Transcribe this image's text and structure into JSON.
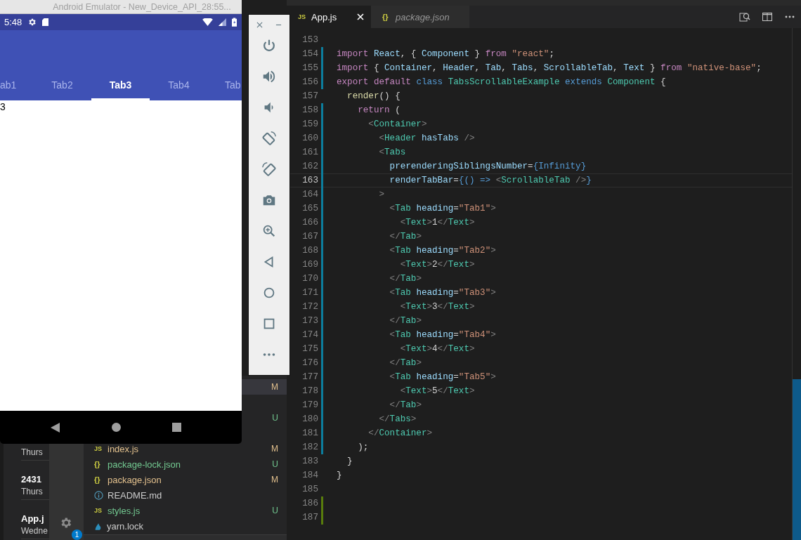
{
  "emulator": {
    "title": "Android Emulator - New_Device_API_28:55...",
    "clock": "5:48",
    "tabs": [
      {
        "label": "ab1",
        "selected": false
      },
      {
        "label": "Tab2",
        "selected": false
      },
      {
        "label": "Tab3",
        "selected": true
      },
      {
        "label": "Tab4",
        "selected": false
      },
      {
        "label": "Tab",
        "selected": false
      }
    ],
    "content": "3"
  },
  "editor": {
    "tabs": [
      {
        "label": "App.js",
        "icon_text": "JS",
        "selected": true,
        "preview": false
      },
      {
        "label": "package.json",
        "icon_text": "{}",
        "selected": false,
        "preview": true
      }
    ],
    "lines": [
      {
        "number": "153",
        "current": false
      },
      {
        "number": "154",
        "current": false,
        "color": "#0c7d9d",
        "tokens": [
          {
            "t": "import",
            "kind": "keyword"
          },
          {
            "t": " React",
            "kind": "variable"
          },
          {
            "t": ", {",
            "kind": "plain"
          },
          {
            "t": " Component",
            "kind": "variable"
          },
          {
            "t": " }",
            "kind": "plain"
          },
          {
            "t": " from",
            "kind": "keyword"
          },
          {
            "t": " \"react\"",
            "kind": "string"
          },
          {
            "t": ";",
            "kind": "plain"
          }
        ]
      },
      {
        "number": "155",
        "current": false,
        "color": "#0c7d9d",
        "tokens": [
          {
            "t": "import",
            "kind": "keyword"
          },
          {
            "t": " {",
            "kind": "plain"
          },
          {
            "t": " Container",
            "kind": "variable"
          },
          {
            "t": ",",
            "kind": "plain"
          },
          {
            "t": " Header",
            "kind": "variable"
          },
          {
            "t": ",",
            "kind": "plain"
          },
          {
            "t": " Tab",
            "kind": "variable"
          },
          {
            "t": ",",
            "kind": "plain"
          },
          {
            "t": " Tabs",
            "kind": "variable"
          },
          {
            "t": ",",
            "kind": "plain"
          },
          {
            "t": " ScrollableTab",
            "kind": "variable"
          },
          {
            "t": ",",
            "kind": "plain"
          },
          {
            "t": " Text",
            "kind": "variable"
          },
          {
            "t": " }",
            "kind": "plain"
          },
          {
            "t": " from",
            "kind": "keyword"
          },
          {
            "t": " \"native-base\"",
            "kind": "string"
          },
          {
            "t": ";",
            "kind": "plain"
          }
        ]
      },
      {
        "number": "156",
        "current": false,
        "color": "#0c7d9d",
        "tokens": [
          {
            "t": "export",
            "kind": "keyword"
          },
          {
            "t": " default",
            "kind": "keyword"
          },
          {
            "t": " class",
            "kind": "storage"
          },
          {
            "t": " TabsScrollableExample",
            "kind": "class"
          },
          {
            "t": " extends",
            "kind": "storage"
          },
          {
            "t": " Component",
            "kind": "class"
          },
          {
            "t": " {",
            "kind": "plain"
          }
        ]
      },
      {
        "number": "157",
        "current": false,
        "tokens": [
          {
            "t": "  render",
            "kind": "function"
          },
          {
            "t": "() {",
            "kind": "plain"
          }
        ]
      },
      {
        "number": "158",
        "current": false,
        "color": "#0c7d9d",
        "tokens": [
          {
            "t": "    return",
            "kind": "keyword"
          },
          {
            "t": " (",
            "kind": "plain"
          }
        ]
      },
      {
        "number": "159",
        "current": false,
        "color": "#0c7d9d",
        "tokens": [
          {
            "t": "      <",
            "kind": "bracket"
          },
          {
            "t": "Container",
            "kind": "class"
          },
          {
            "t": ">",
            "kind": "bracket"
          }
        ]
      },
      {
        "number": "160",
        "current": false,
        "color": "#0c7d9d",
        "tokens": [
          {
            "t": "        <",
            "kind": "bracket"
          },
          {
            "t": "Header",
            "kind": "class"
          },
          {
            "t": " hasTabs",
            "kind": "variable"
          },
          {
            "t": " />",
            "kind": "bracket"
          }
        ]
      },
      {
        "number": "161",
        "current": false,
        "color": "#0c7d9d",
        "tokens": [
          {
            "t": "        <",
            "kind": "bracket"
          },
          {
            "t": "Tabs",
            "kind": "class"
          }
        ]
      },
      {
        "number": "162",
        "current": false,
        "color": "#0c7d9d",
        "tokens": [
          {
            "t": "          prerenderingSiblingsNumber",
            "kind": "variable"
          },
          {
            "t": "=",
            "kind": "plain"
          },
          {
            "t": "{Infinity}",
            "kind": "storage"
          }
        ]
      },
      {
        "number": "163",
        "current": true,
        "color": "#0c7d9d",
        "tokens": [
          {
            "t": "          renderTabBar",
            "kind": "variable"
          },
          {
            "t": "=",
            "kind": "plain"
          },
          {
            "t": "{() =>",
            "kind": "storage"
          },
          {
            "t": " <",
            "kind": "bracket"
          },
          {
            "t": "ScrollableTab",
            "kind": "class"
          },
          {
            "t": " />",
            "kind": "bracket"
          },
          {
            "t": "}",
            "kind": "storage"
          }
        ]
      },
      {
        "number": "164",
        "current": false,
        "color": "#0c7d9d",
        "tokens": [
          {
            "t": "        >",
            "kind": "bracket"
          }
        ]
      },
      {
        "number": "165",
        "current": false,
        "color": "#0c7d9d",
        "tokens": [
          {
            "t": "          <",
            "kind": "bracket"
          },
          {
            "t": "Tab",
            "kind": "class"
          },
          {
            "t": " heading",
            "kind": "variable"
          },
          {
            "t": "=",
            "kind": "plain"
          },
          {
            "t": "\"Tab1\"",
            "kind": "string"
          },
          {
            "t": ">",
            "kind": "bracket"
          }
        ]
      },
      {
        "number": "166",
        "current": false,
        "color": "#0c7d9d",
        "tokens": [
          {
            "t": "            <",
            "kind": "bracket"
          },
          {
            "t": "Text",
            "kind": "class"
          },
          {
            "t": ">",
            "kind": "bracket"
          },
          {
            "t": "1",
            "kind": "plain"
          },
          {
            "t": "</",
            "kind": "bracket"
          },
          {
            "t": "Text",
            "kind": "class"
          },
          {
            "t": ">",
            "kind": "bracket"
          }
        ]
      },
      {
        "number": "167",
        "current": false,
        "color": "#0c7d9d",
        "tokens": [
          {
            "t": "          </",
            "kind": "bracket"
          },
          {
            "t": "Tab",
            "kind": "class"
          },
          {
            "t": ">",
            "kind": "bracket"
          }
        ]
      },
      {
        "number": "168",
        "current": false,
        "color": "#0c7d9d",
        "tokens": [
          {
            "t": "          <",
            "kind": "bracket"
          },
          {
            "t": "Tab",
            "kind": "class"
          },
          {
            "t": " heading",
            "kind": "variable"
          },
          {
            "t": "=",
            "kind": "plain"
          },
          {
            "t": "\"Tab2\"",
            "kind": "string"
          },
          {
            "t": ">",
            "kind": "bracket"
          }
        ]
      },
      {
        "number": "169",
        "current": false,
        "color": "#0c7d9d",
        "tokens": [
          {
            "t": "            <",
            "kind": "bracket"
          },
          {
            "t": "Text",
            "kind": "class"
          },
          {
            "t": ">",
            "kind": "bracket"
          },
          {
            "t": "2",
            "kind": "plain"
          },
          {
            "t": "</",
            "kind": "bracket"
          },
          {
            "t": "Text",
            "kind": "class"
          },
          {
            "t": ">",
            "kind": "bracket"
          }
        ]
      },
      {
        "number": "170",
        "current": false,
        "color": "#0c7d9d",
        "tokens": [
          {
            "t": "          </",
            "kind": "bracket"
          },
          {
            "t": "Tab",
            "kind": "class"
          },
          {
            "t": ">",
            "kind": "bracket"
          }
        ]
      },
      {
        "number": "171",
        "current": false,
        "color": "#0c7d9d",
        "tokens": [
          {
            "t": "          <",
            "kind": "bracket"
          },
          {
            "t": "Tab",
            "kind": "class"
          },
          {
            "t": " heading",
            "kind": "variable"
          },
          {
            "t": "=",
            "kind": "plain"
          },
          {
            "t": "\"Tab3\"",
            "kind": "string"
          },
          {
            "t": ">",
            "kind": "bracket"
          }
        ]
      },
      {
        "number": "172",
        "current": false,
        "color": "#0c7d9d",
        "tokens": [
          {
            "t": "            <",
            "kind": "bracket"
          },
          {
            "t": "Text",
            "kind": "class"
          },
          {
            "t": ">",
            "kind": "bracket"
          },
          {
            "t": "3",
            "kind": "plain"
          },
          {
            "t": "</",
            "kind": "bracket"
          },
          {
            "t": "Text",
            "kind": "class"
          },
          {
            "t": ">",
            "kind": "bracket"
          }
        ]
      },
      {
        "number": "173",
        "current": false,
        "color": "#0c7d9d",
        "tokens": [
          {
            "t": "          </",
            "kind": "bracket"
          },
          {
            "t": "Tab",
            "kind": "class"
          },
          {
            "t": ">",
            "kind": "bracket"
          }
        ]
      },
      {
        "number": "174",
        "current": false,
        "color": "#0c7d9d",
        "tokens": [
          {
            "t": "          <",
            "kind": "bracket"
          },
          {
            "t": "Tab",
            "kind": "class"
          },
          {
            "t": " heading",
            "kind": "variable"
          },
          {
            "t": "=",
            "kind": "plain"
          },
          {
            "t": "\"Tab4\"",
            "kind": "string"
          },
          {
            "t": ">",
            "kind": "bracket"
          }
        ]
      },
      {
        "number": "175",
        "current": false,
        "color": "#0c7d9d",
        "tokens": [
          {
            "t": "            <",
            "kind": "bracket"
          },
          {
            "t": "Text",
            "kind": "class"
          },
          {
            "t": ">",
            "kind": "bracket"
          },
          {
            "t": "4",
            "kind": "plain"
          },
          {
            "t": "</",
            "kind": "bracket"
          },
          {
            "t": "Text",
            "kind": "class"
          },
          {
            "t": ">",
            "kind": "bracket"
          }
        ]
      },
      {
        "number": "176",
        "current": false,
        "color": "#0c7d9d",
        "tokens": [
          {
            "t": "          </",
            "kind": "bracket"
          },
          {
            "t": "Tab",
            "kind": "class"
          },
          {
            "t": ">",
            "kind": "bracket"
          }
        ]
      },
      {
        "number": "177",
        "current": false,
        "color": "#0c7d9d",
        "tokens": [
          {
            "t": "          <",
            "kind": "bracket"
          },
          {
            "t": "Tab",
            "kind": "class"
          },
          {
            "t": " heading",
            "kind": "variable"
          },
          {
            "t": "=",
            "kind": "plain"
          },
          {
            "t": "\"Tab5\"",
            "kind": "string"
          },
          {
            "t": ">",
            "kind": "bracket"
          }
        ]
      },
      {
        "number": "178",
        "current": false,
        "color": "#0c7d9d",
        "tokens": [
          {
            "t": "            <",
            "kind": "bracket"
          },
          {
            "t": "Text",
            "kind": "class"
          },
          {
            "t": ">",
            "kind": "bracket"
          },
          {
            "t": "5",
            "kind": "plain"
          },
          {
            "t": "</",
            "kind": "bracket"
          },
          {
            "t": "Text",
            "kind": "class"
          },
          {
            "t": ">",
            "kind": "bracket"
          }
        ]
      },
      {
        "number": "179",
        "current": false,
        "color": "#0c7d9d",
        "tokens": [
          {
            "t": "          </",
            "kind": "bracket"
          },
          {
            "t": "Tab",
            "kind": "class"
          },
          {
            "t": ">",
            "kind": "bracket"
          }
        ]
      },
      {
        "number": "180",
        "current": false,
        "color": "#0c7d9d",
        "tokens": [
          {
            "t": "        </",
            "kind": "bracket"
          },
          {
            "t": "Tabs",
            "kind": "class"
          },
          {
            "t": ">",
            "kind": "bracket"
          }
        ]
      },
      {
        "number": "181",
        "current": false,
        "color": "#0c7d9d",
        "tokens": [
          {
            "t": "      </",
            "kind": "bracket"
          },
          {
            "t": "Container",
            "kind": "class"
          },
          {
            "t": ">",
            "kind": "bracket"
          }
        ]
      },
      {
        "number": "182",
        "current": false,
        "color": "#0c7d9d",
        "tokens": [
          {
            "t": "    );",
            "kind": "plain"
          }
        ]
      },
      {
        "number": "183",
        "current": false,
        "tokens": [
          {
            "t": "  }",
            "kind": "plain"
          }
        ]
      },
      {
        "number": "184",
        "current": false,
        "tokens": [
          {
            "t": "}",
            "kind": "plain"
          }
        ]
      },
      {
        "number": "185",
        "current": false
      },
      {
        "number": "186",
        "current": false,
        "color": "#587c0c"
      },
      {
        "number": "187",
        "current": false,
        "color": "#587c0c"
      }
    ]
  },
  "explorer": {
    "rows": [
      {
        "status": "M",
        "selected": true
      },
      {
        "status": "U",
        "selected": false
      },
      {
        "name": "index.js",
        "kind": "script",
        "icon_text": "JS",
        "status": "M",
        "selected": false
      },
      {
        "name": "package-lock.json",
        "kind": "data",
        "icon_text": "{}",
        "status": "U",
        "selected": false
      },
      {
        "name": "package.json",
        "kind": "data",
        "icon_text": "{}",
        "status": "M",
        "selected": false
      },
      {
        "name": "README.md",
        "kind": "info",
        "selected": false
      },
      {
        "name": "styles.js",
        "kind": "script",
        "icon_text": "JS",
        "status": "U",
        "selected": false
      },
      {
        "name": "yarn.lock",
        "kind": "package",
        "selected": false
      }
    ]
  },
  "activity": {
    "badge": "1"
  },
  "history": [
    {
      "subtitle": "Thurs"
    },
    {
      "title": "2431",
      "subtitle": "Thurs"
    },
    {
      "title": "App.j",
      "subtitle": "Wedne"
    }
  ]
}
